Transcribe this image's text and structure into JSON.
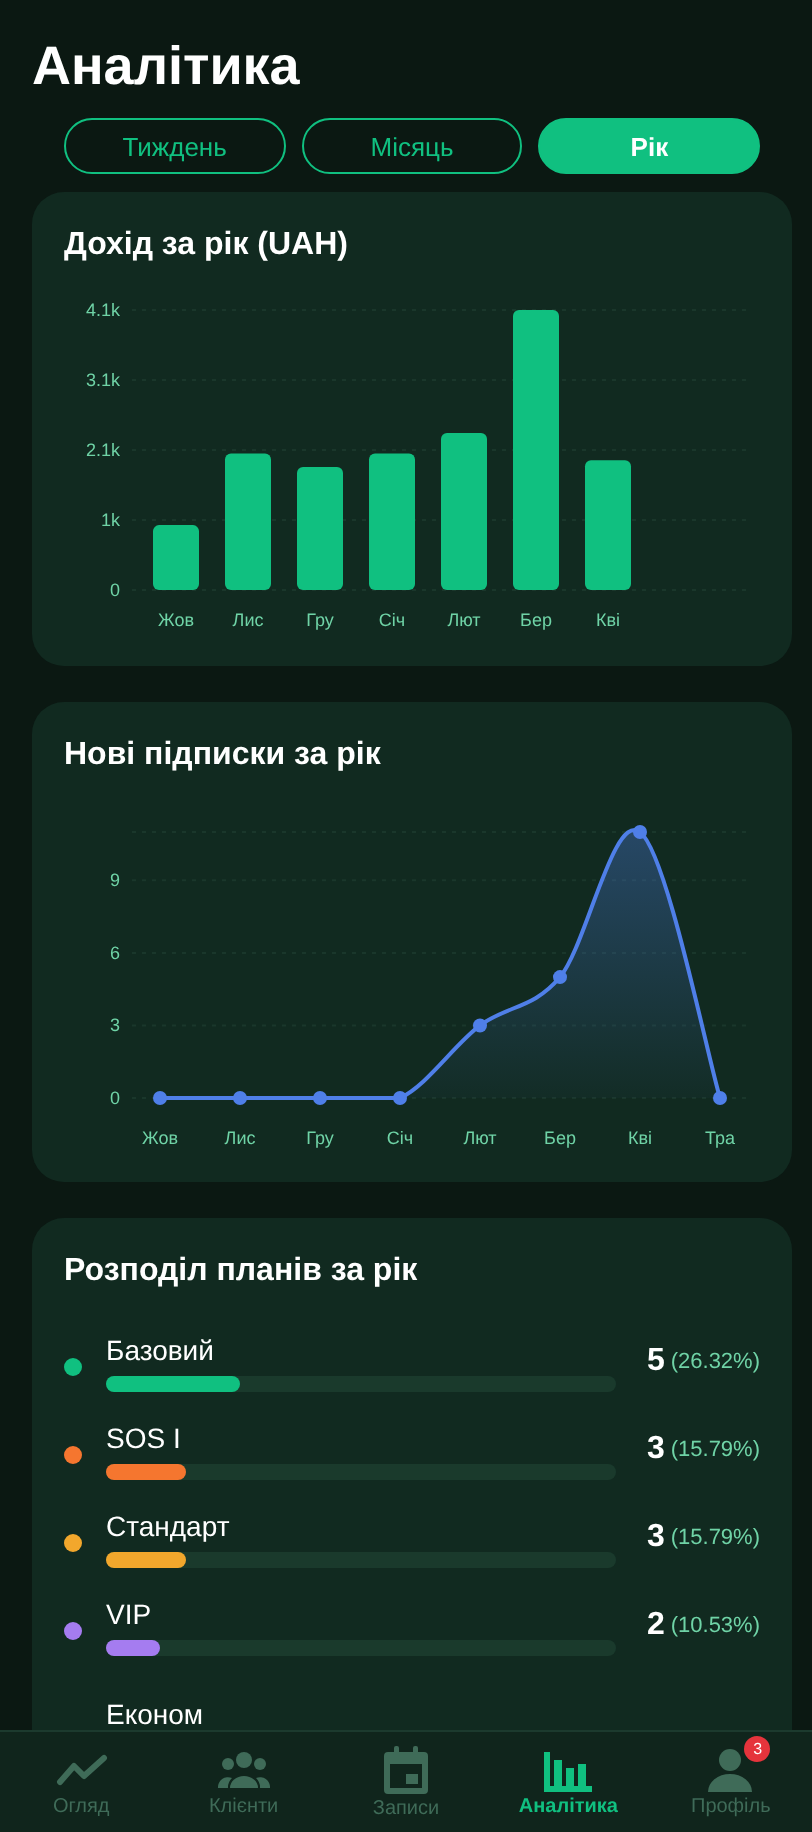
{
  "header": {
    "title": "Аналітика"
  },
  "period_tabs": [
    {
      "label": "Тиждень",
      "selected": false
    },
    {
      "label": "Місяць",
      "selected": false
    },
    {
      "label": "Рік",
      "selected": true
    }
  ],
  "revenue_card": {
    "title": "Дохід за рік (UAH)",
    "chart_data": {
      "type": "bar",
      "categories": [
        "Жов",
        "Лис",
        "Гру",
        "Січ",
        "Лют",
        "Бер",
        "Кві"
      ],
      "values": [
        950,
        2000,
        1800,
        2000,
        2300,
        4100,
        1900
      ],
      "ylim": [
        0,
        4100
      ],
      "grid": true,
      "yticks": [
        {
          "value": 0,
          "label": "0"
        },
        {
          "value": 1025,
          "label": "1k"
        },
        {
          "value": 2050,
          "label": "2.1k"
        },
        {
          "value": 3075,
          "label": "3.1k"
        },
        {
          "value": 4100,
          "label": "4.1k"
        }
      ]
    }
  },
  "subscriptions_card": {
    "title": "Нові підписки за рік",
    "chart_data": {
      "type": "area",
      "categories": [
        "Жов",
        "Лис",
        "Гру",
        "Січ",
        "Лют",
        "Бер",
        "Кві",
        "Тра"
      ],
      "series": [
        {
          "color": "#4f7fe8",
          "values": [
            0,
            0,
            0,
            0,
            3,
            5,
            11,
            0
          ]
        }
      ],
      "ylim": [
        0,
        11
      ],
      "grid": true,
      "yticks": [
        0,
        3,
        6,
        9
      ]
    }
  },
  "plans_card": {
    "title": "Розподіл планів за рік",
    "plans": [
      {
        "name": "Базовий",
        "color": "#10c080",
        "level": 0.2632,
        "count": "5",
        "share": "(26.32%)"
      },
      {
        "name": "SOS I",
        "color": "#f5762f",
        "level": 0.1579,
        "count": "3",
        "share": "(15.79%)"
      },
      {
        "name": "Стандарт",
        "color": "#f2a72c",
        "level": 0.1579,
        "count": "3",
        "share": "(15.79%)"
      },
      {
        "name": "VIP",
        "color": "#a57cf0",
        "level": 0.1053,
        "count": "2",
        "share": "(10.53%)"
      },
      {
        "name": "Економ"
      }
    ]
  },
  "bottom_nav": [
    {
      "label": "Огляд",
      "selected": false
    },
    {
      "label": "Клієнти",
      "selected": false
    },
    {
      "label": "Записи",
      "selected": false
    },
    {
      "label": "Аналітика",
      "selected": true
    },
    {
      "label": "Профіль",
      "selected": false,
      "badge": "3"
    }
  ]
}
